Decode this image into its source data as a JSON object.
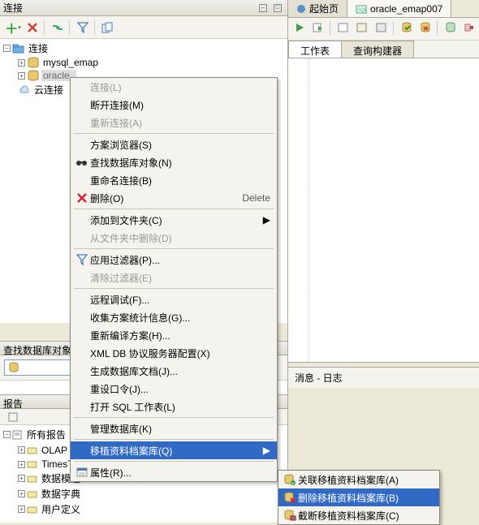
{
  "left_panel_title": "连接",
  "tree": {
    "root": "连接",
    "items": [
      "mysql_emap",
      "oracle_",
      "云连接"
    ]
  },
  "ctx1": [
    {
      "label": "连接(L)",
      "disabled": true
    },
    {
      "label": "断开连接(M)"
    },
    {
      "label": "重新连接(A)",
      "disabled": true
    },
    {
      "sep": true
    },
    {
      "label": "方案浏览器(S)"
    },
    {
      "label": "查找数据库对象(N)",
      "icon": "binoculars"
    },
    {
      "label": "重命名连接(B)"
    },
    {
      "label": "删除(O)",
      "icon": "delete",
      "shortcut": "Delete"
    },
    {
      "sep": true
    },
    {
      "label": "添加到文件夹(C)",
      "sub": true
    },
    {
      "label": "从文件夹中删除(D)",
      "disabled": true
    },
    {
      "sep": true
    },
    {
      "label": "应用过滤器(P)...",
      "icon": "filter"
    },
    {
      "label": "清除过滤器(E)",
      "disabled": true
    },
    {
      "sep": true
    },
    {
      "label": "远程调试(F)..."
    },
    {
      "label": "收集方案统计信息(G)..."
    },
    {
      "label": "重新编译方案(H)..."
    },
    {
      "label": "XML DB 协议服务器配置(X)"
    },
    {
      "label": "生成数据库文档(J)..."
    },
    {
      "label": "重设口令(J)..."
    },
    {
      "label": "打开 SQL 工作表(L)"
    },
    {
      "sep": true
    },
    {
      "label": "管理数据库(K)"
    },
    {
      "sep": true
    },
    {
      "label": "移植资料档案库(Q)",
      "sub": true,
      "hl": true
    },
    {
      "sep": true
    },
    {
      "label": "属性(R)...",
      "icon": "properties"
    }
  ],
  "ctx2": [
    {
      "label": "关联移植资料档案库(A)",
      "icon": "db-link"
    },
    {
      "label": "删除移植资料档案库(B)",
      "icon": "db-delete",
      "hl": true
    },
    {
      "label": "截断移植资料档案库(C)",
      "icon": "db-truncate"
    }
  ],
  "search_panel_title": "查找数据库对象",
  "reports_panel_title": "报告",
  "reports_items": [
    "所有报告",
    "OLAP 报",
    "TimesTe",
    "数据模造",
    "数据字典",
    "用户定义"
  ],
  "tabs": [
    {
      "label": "起始页"
    },
    {
      "label": "oracle_emap007",
      "active": true
    }
  ],
  "subtabs": [
    {
      "label": "工作表",
      "active": true
    },
    {
      "label": "查询构建器"
    }
  ],
  "messages_title": "消息 - 日志"
}
